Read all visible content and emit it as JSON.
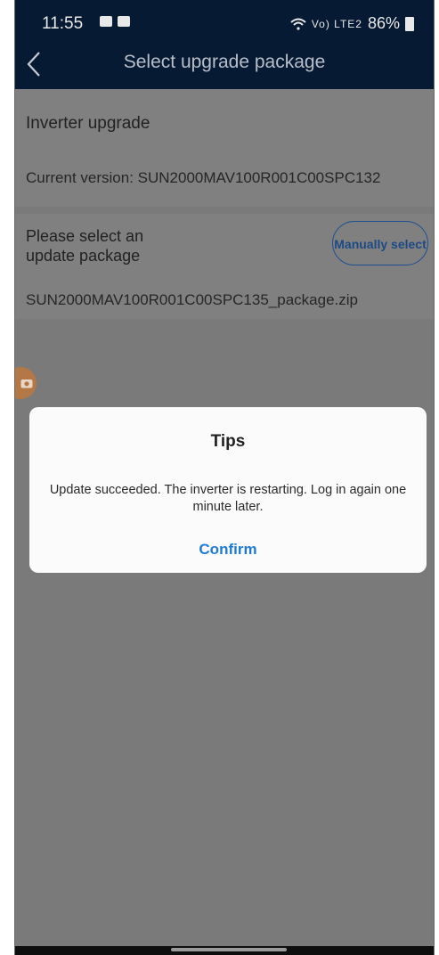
{
  "status_bar": {
    "time": "11:55",
    "signal_text": "Vo) LTE2",
    "battery": "86%"
  },
  "header": {
    "title": "Select upgrade package"
  },
  "content": {
    "section_title": "Inverter upgrade",
    "current_version": "Current version: SUN2000MAV100R001C00SPC132",
    "select_prompt": "Please select an update package",
    "manual_select_button": "Manually select",
    "selected_file": "SUN2000MAV100R001C00SPC135_package.zip"
  },
  "dialog": {
    "title": "Tips",
    "message": "Update succeeded. The inverter is restarting. Log in again one minute later.",
    "confirm_label": "Confirm"
  },
  "colors": {
    "header_bg": "#071a33",
    "accent": "#1f7ad6",
    "overlay_bg": "#7a7a7a"
  },
  "icons": [
    "video-icon",
    "image-icon",
    "wifi-icon",
    "signal-icon",
    "battery-icon",
    "back-arrow-icon",
    "camera-icon"
  ]
}
